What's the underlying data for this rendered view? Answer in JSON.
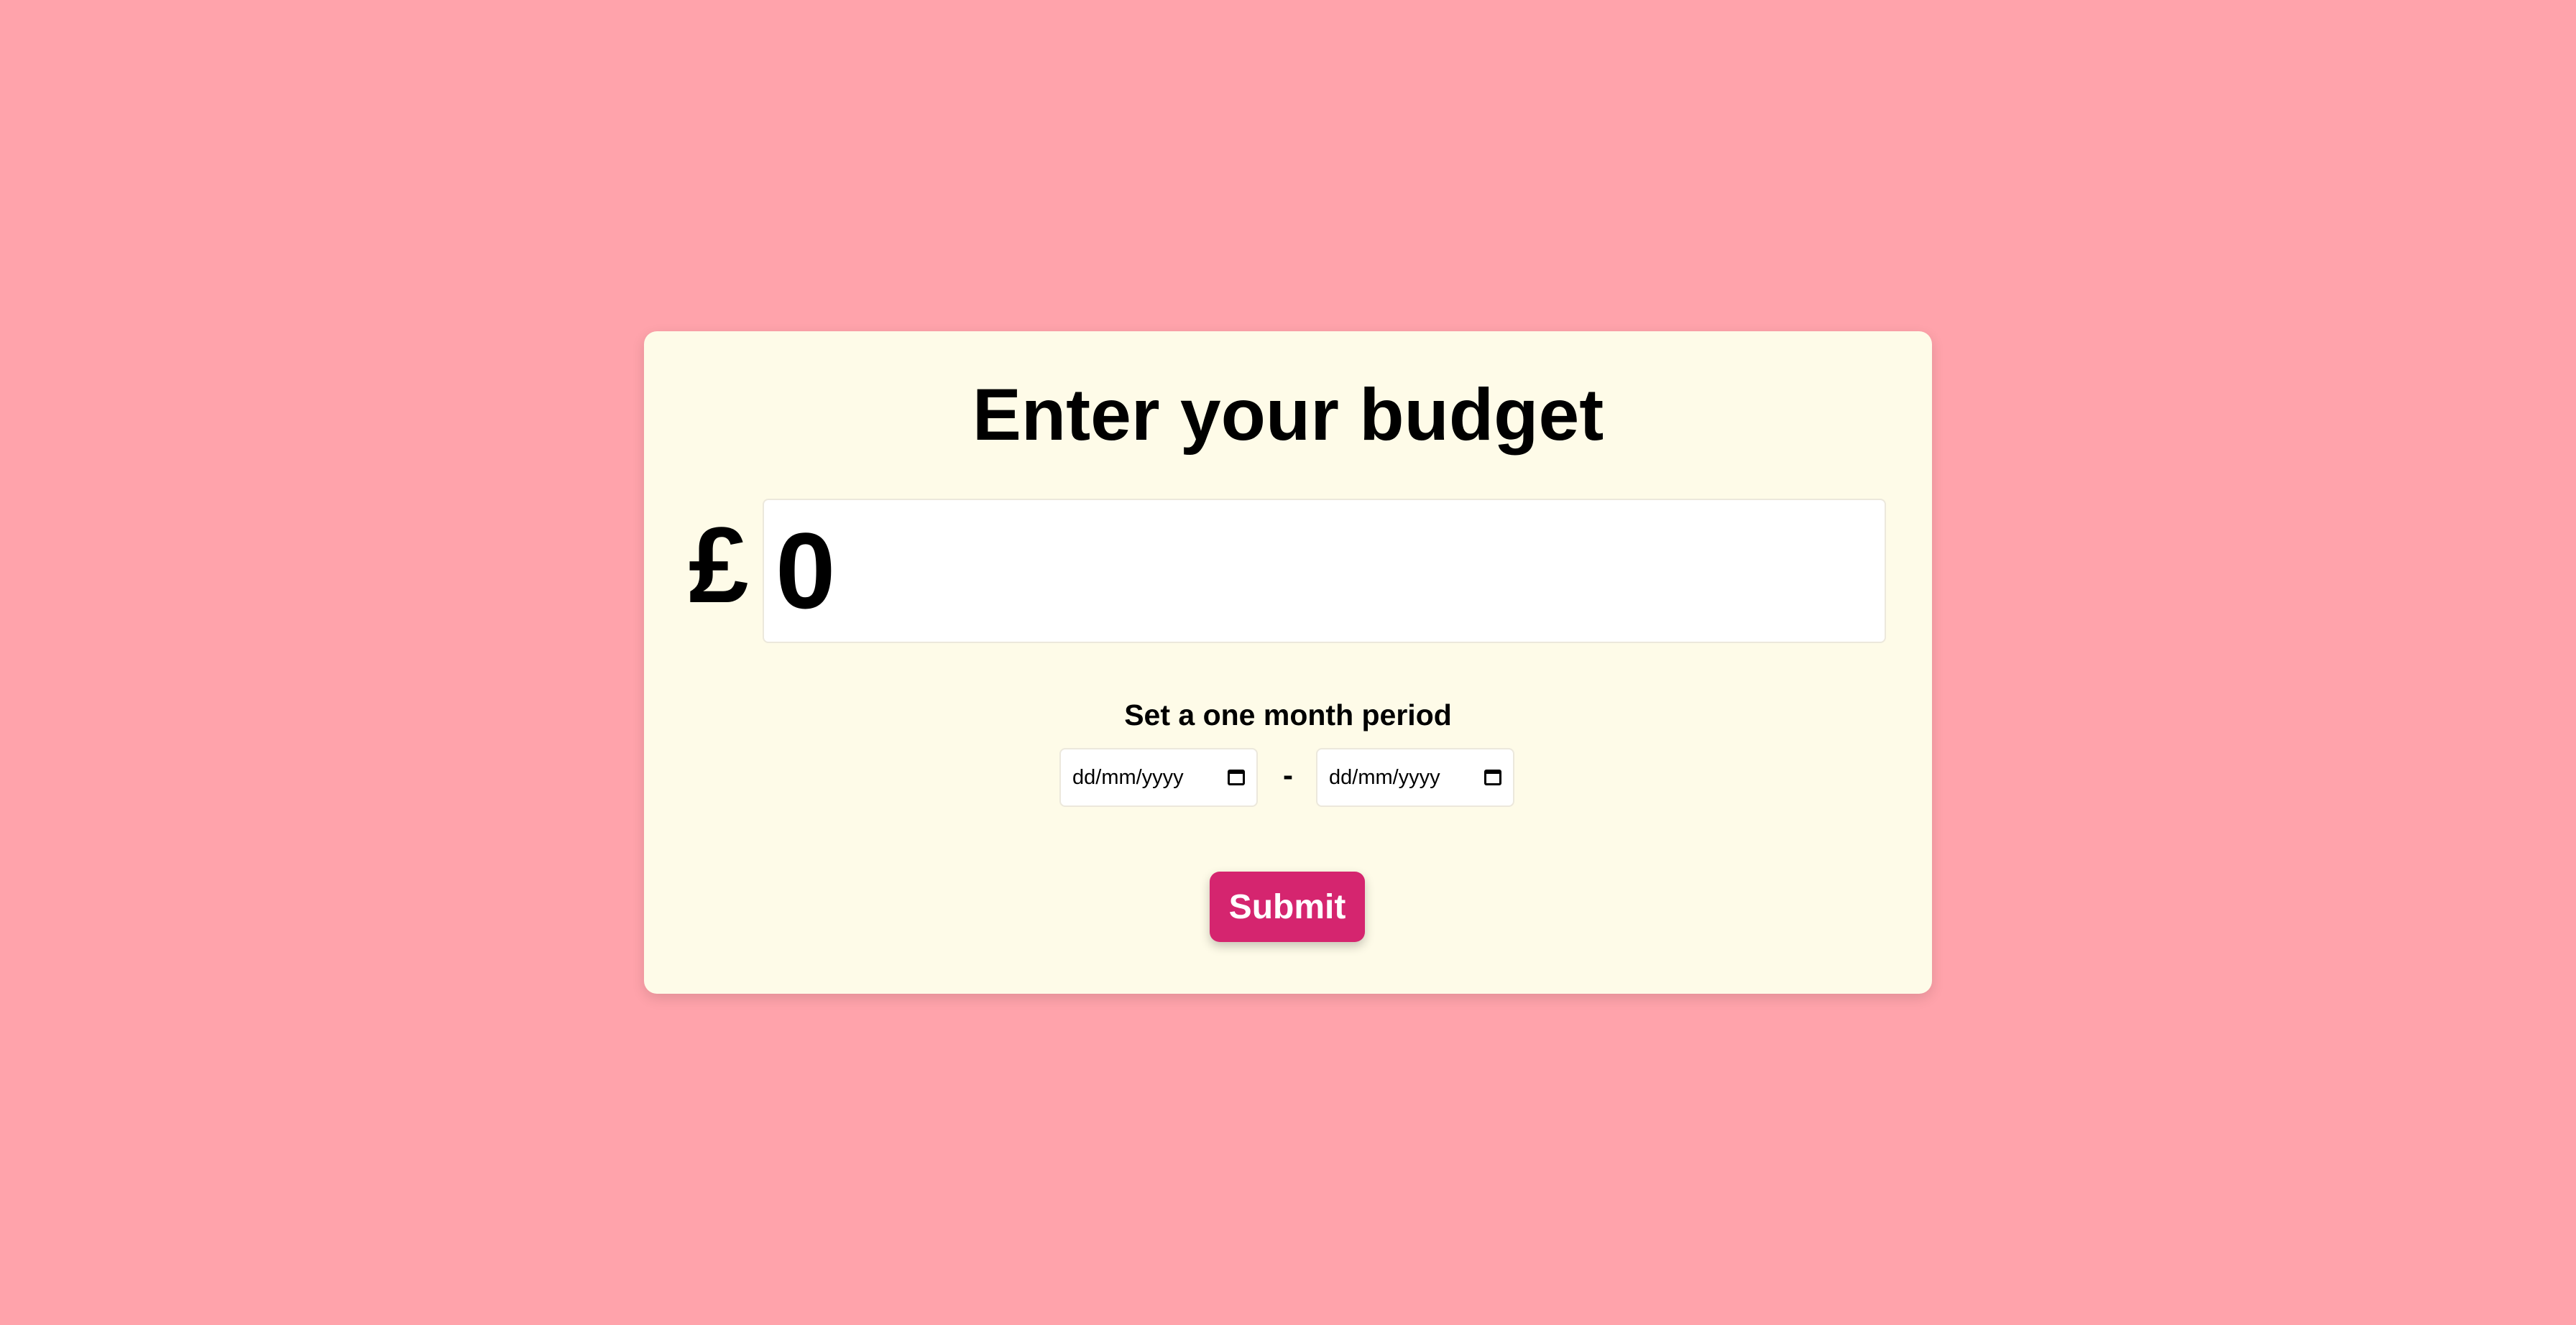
{
  "form": {
    "title": "Enter your budget",
    "currency_symbol": "£",
    "amount_value": "0",
    "period_label": "Set a one month period",
    "start_date_placeholder": "dd/mm/yyyy",
    "end_date_placeholder": "dd/mm/yyyy",
    "date_separator": "-",
    "submit_label": "Submit"
  },
  "icons": {
    "date_picker": "calendar-icon"
  },
  "colors": {
    "background": "#ffa3ab",
    "card": "#fefbe8",
    "submit_button": "#d5256f"
  }
}
